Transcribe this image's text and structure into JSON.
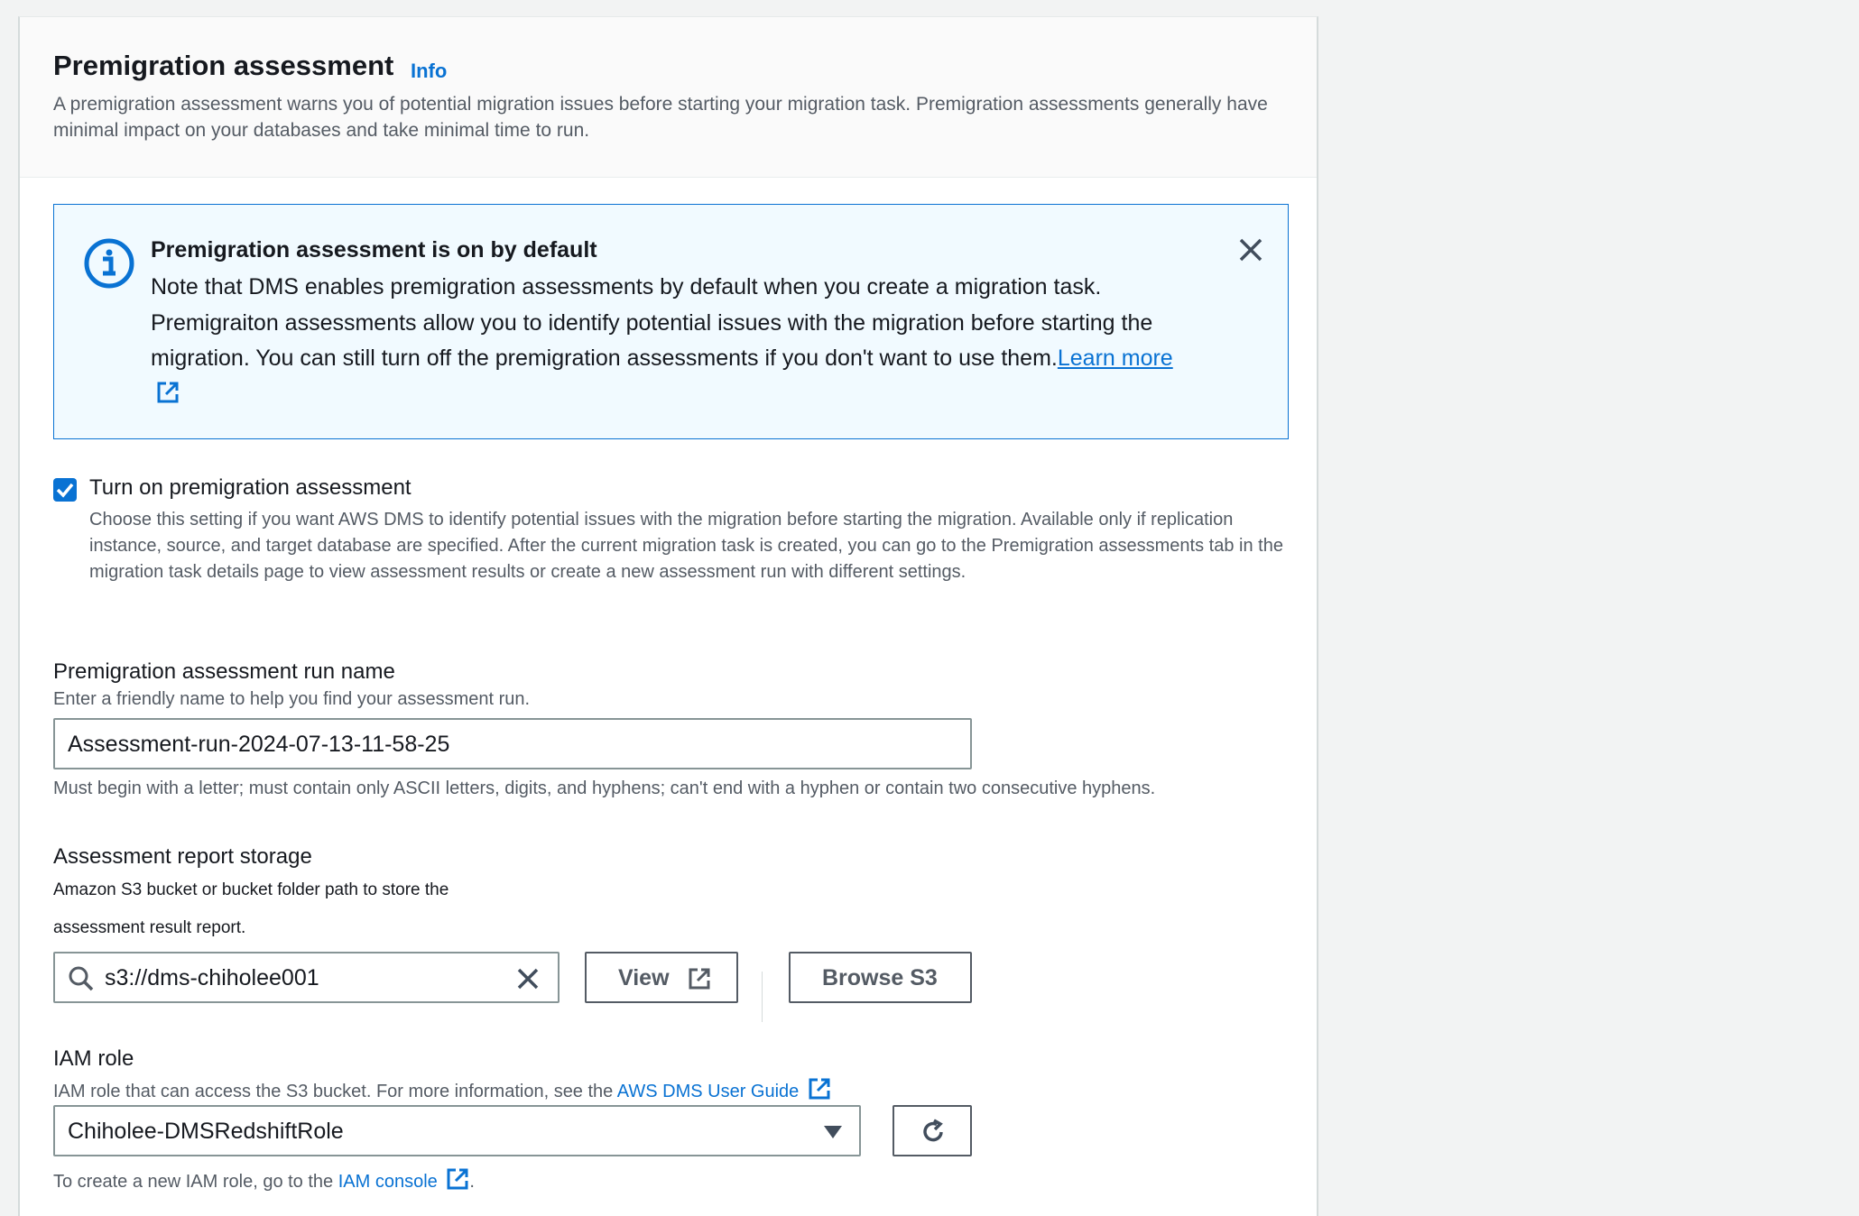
{
  "header": {
    "title": "Premigration assessment",
    "info_link": "Info",
    "description": "A premigration assessment warns you of potential migration issues before starting your migration task. Premigration assessments generally have minimal impact on your databases and take minimal time to run."
  },
  "alert": {
    "title": "Premigration assessment is on by default",
    "body": "Note that DMS enables premigration assessments by default when you create a migration task. Premigraiton assessments allow you to identify potential issues with the migration before starting the migration. You can still turn off the premigration assessments if you don't want to use them.",
    "learn_more": "Learn more",
    "icon": "info-circle-icon",
    "close_icon": "close-icon",
    "accent_color": "#0972d3",
    "background_color": "#f1faff"
  },
  "turn_on": {
    "checked": true,
    "label": "Turn on premigration assessment",
    "description": "Choose this setting if you want AWS DMS to identify potential issues with the migration before starting the migration. Available only if replication instance, source, and target database are specified. After the current migration task is created, you can go to the Premigration assessments tab in the migration task details page to view assessment results or create a new assessment run with different settings."
  },
  "run_name": {
    "label": "Premigration assessment run name",
    "description": "Enter a friendly name to help you find your assessment run.",
    "value": "Assessment-run-2024-07-13-11-58-25",
    "constraint": "Must begin with a letter; must contain only ASCII letters, digits, and hyphens; can't end with a hyphen or contain two consecutive hyphens."
  },
  "storage": {
    "label": "Assessment report storage",
    "description_line1": "Amazon S3 bucket or bucket folder path to store the",
    "description_line2": "assessment result report.",
    "value": "s3://dms-chiholee001",
    "view_button": "View",
    "browse_button": "Browse S3"
  },
  "iam": {
    "label": "IAM role",
    "description": "IAM role that can access the S3 bucket. For more information, see the",
    "guide_link": "AWS DMS User Guide",
    "selected": "Chiholee-DMSRedshiftRole",
    "footer_prefix": "To create a new IAM role, go to the",
    "console_link": "IAM console",
    "footer_suffix": "."
  }
}
